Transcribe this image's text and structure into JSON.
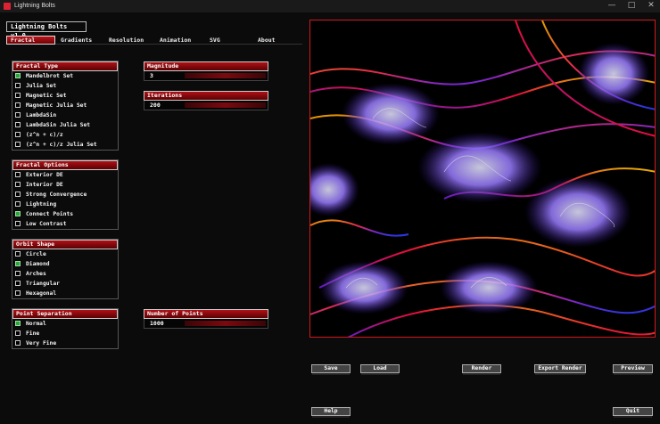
{
  "window": {
    "title": "Lightning Bolts",
    "minimize": "—",
    "maximize": "□",
    "close": "✕"
  },
  "version": "Lightning Bolts v1.0",
  "tabs": [
    "Fractal",
    "Gradients",
    "Resolution",
    "Animation",
    "SVG",
    "About"
  ],
  "active_tab": "Fractal",
  "fractal_type": {
    "title": "Fractal Type",
    "options": [
      {
        "label": "Mandelbrot Set",
        "checked": true
      },
      {
        "label": "Julia Set",
        "checked": false
      },
      {
        "label": "Magnetic Set",
        "checked": false
      },
      {
        "label": "Magnetic Julia Set",
        "checked": false
      },
      {
        "label": "LambdaSin",
        "checked": false
      },
      {
        "label": "LambdaSin Julia Set",
        "checked": false
      },
      {
        "label": "(z^n + c)/z",
        "checked": false
      },
      {
        "label": "(z^n + c)/z Julia Set",
        "checked": false
      }
    ]
  },
  "fractal_options": {
    "title": "Fractal Options",
    "options": [
      {
        "label": "Exterior DE",
        "checked": false
      },
      {
        "label": "Interior DE",
        "checked": false
      },
      {
        "label": "Strong Convergence",
        "checked": false
      },
      {
        "label": "Lightning",
        "checked": false
      },
      {
        "label": "Connect Points",
        "checked": true
      },
      {
        "label": "Low Contrast",
        "checked": false
      }
    ]
  },
  "orbit_shape": {
    "title": "Orbit Shape",
    "options": [
      {
        "label": "Circle",
        "checked": false
      },
      {
        "label": "Diamond",
        "checked": true
      },
      {
        "label": "Arches",
        "checked": false
      },
      {
        "label": "Triangular",
        "checked": false
      },
      {
        "label": "Hexagonal",
        "checked": false
      }
    ]
  },
  "point_separation": {
    "title": "Point Separation",
    "options": [
      {
        "label": "Normal",
        "checked": true
      },
      {
        "label": "Fine",
        "checked": false
      },
      {
        "label": "Very Fine",
        "checked": false
      }
    ]
  },
  "magnitude": {
    "label": "Magnitude",
    "value": "3"
  },
  "iterations": {
    "label": "Iterations",
    "value": "200"
  },
  "num_points": {
    "label": "Number of Points",
    "value": "1000"
  },
  "buttons": {
    "save": "Save",
    "load": "Load",
    "render": "Render",
    "export": "Export Render",
    "preview": "Preview",
    "help": "Help",
    "quit": "Quit"
  },
  "colors": {
    "accent": "#c0141a",
    "frame": "#d31a1f",
    "checked": "#2ca53b"
  }
}
